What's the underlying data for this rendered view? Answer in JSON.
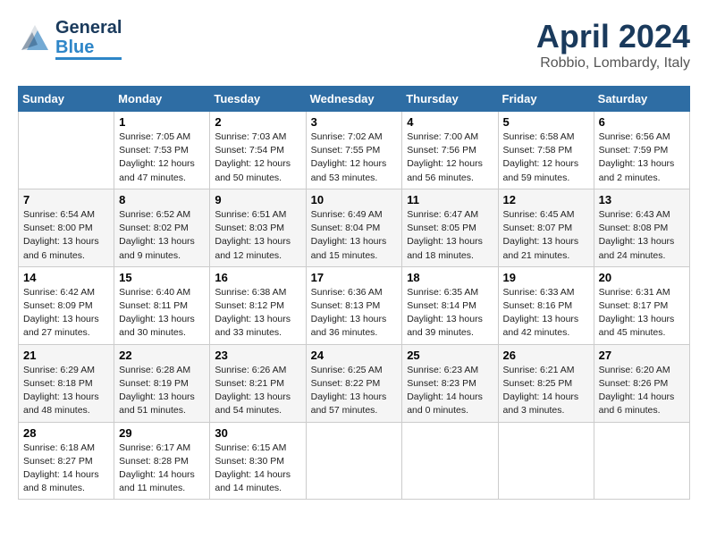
{
  "header": {
    "logo_line1": "General",
    "logo_line2": "Blue",
    "title": "April 2024",
    "subtitle": "Robbio, Lombardy, Italy"
  },
  "columns": [
    "Sunday",
    "Monday",
    "Tuesday",
    "Wednesday",
    "Thursday",
    "Friday",
    "Saturday"
  ],
  "weeks": [
    [
      {
        "num": "",
        "info": ""
      },
      {
        "num": "1",
        "info": "Sunrise: 7:05 AM\nSunset: 7:53 PM\nDaylight: 12 hours\nand 47 minutes."
      },
      {
        "num": "2",
        "info": "Sunrise: 7:03 AM\nSunset: 7:54 PM\nDaylight: 12 hours\nand 50 minutes."
      },
      {
        "num": "3",
        "info": "Sunrise: 7:02 AM\nSunset: 7:55 PM\nDaylight: 12 hours\nand 53 minutes."
      },
      {
        "num": "4",
        "info": "Sunrise: 7:00 AM\nSunset: 7:56 PM\nDaylight: 12 hours\nand 56 minutes."
      },
      {
        "num": "5",
        "info": "Sunrise: 6:58 AM\nSunset: 7:58 PM\nDaylight: 12 hours\nand 59 minutes."
      },
      {
        "num": "6",
        "info": "Sunrise: 6:56 AM\nSunset: 7:59 PM\nDaylight: 13 hours\nand 2 minutes."
      }
    ],
    [
      {
        "num": "7",
        "info": "Sunrise: 6:54 AM\nSunset: 8:00 PM\nDaylight: 13 hours\nand 6 minutes."
      },
      {
        "num": "8",
        "info": "Sunrise: 6:52 AM\nSunset: 8:02 PM\nDaylight: 13 hours\nand 9 minutes."
      },
      {
        "num": "9",
        "info": "Sunrise: 6:51 AM\nSunset: 8:03 PM\nDaylight: 13 hours\nand 12 minutes."
      },
      {
        "num": "10",
        "info": "Sunrise: 6:49 AM\nSunset: 8:04 PM\nDaylight: 13 hours\nand 15 minutes."
      },
      {
        "num": "11",
        "info": "Sunrise: 6:47 AM\nSunset: 8:05 PM\nDaylight: 13 hours\nand 18 minutes."
      },
      {
        "num": "12",
        "info": "Sunrise: 6:45 AM\nSunset: 8:07 PM\nDaylight: 13 hours\nand 21 minutes."
      },
      {
        "num": "13",
        "info": "Sunrise: 6:43 AM\nSunset: 8:08 PM\nDaylight: 13 hours\nand 24 minutes."
      }
    ],
    [
      {
        "num": "14",
        "info": "Sunrise: 6:42 AM\nSunset: 8:09 PM\nDaylight: 13 hours\nand 27 minutes."
      },
      {
        "num": "15",
        "info": "Sunrise: 6:40 AM\nSunset: 8:11 PM\nDaylight: 13 hours\nand 30 minutes."
      },
      {
        "num": "16",
        "info": "Sunrise: 6:38 AM\nSunset: 8:12 PM\nDaylight: 13 hours\nand 33 minutes."
      },
      {
        "num": "17",
        "info": "Sunrise: 6:36 AM\nSunset: 8:13 PM\nDaylight: 13 hours\nand 36 minutes."
      },
      {
        "num": "18",
        "info": "Sunrise: 6:35 AM\nSunset: 8:14 PM\nDaylight: 13 hours\nand 39 minutes."
      },
      {
        "num": "19",
        "info": "Sunrise: 6:33 AM\nSunset: 8:16 PM\nDaylight: 13 hours\nand 42 minutes."
      },
      {
        "num": "20",
        "info": "Sunrise: 6:31 AM\nSunset: 8:17 PM\nDaylight: 13 hours\nand 45 minutes."
      }
    ],
    [
      {
        "num": "21",
        "info": "Sunrise: 6:29 AM\nSunset: 8:18 PM\nDaylight: 13 hours\nand 48 minutes."
      },
      {
        "num": "22",
        "info": "Sunrise: 6:28 AM\nSunset: 8:19 PM\nDaylight: 13 hours\nand 51 minutes."
      },
      {
        "num": "23",
        "info": "Sunrise: 6:26 AM\nSunset: 8:21 PM\nDaylight: 13 hours\nand 54 minutes."
      },
      {
        "num": "24",
        "info": "Sunrise: 6:25 AM\nSunset: 8:22 PM\nDaylight: 13 hours\nand 57 minutes."
      },
      {
        "num": "25",
        "info": "Sunrise: 6:23 AM\nSunset: 8:23 PM\nDaylight: 14 hours\nand 0 minutes."
      },
      {
        "num": "26",
        "info": "Sunrise: 6:21 AM\nSunset: 8:25 PM\nDaylight: 14 hours\nand 3 minutes."
      },
      {
        "num": "27",
        "info": "Sunrise: 6:20 AM\nSunset: 8:26 PM\nDaylight: 14 hours\nand 6 minutes."
      }
    ],
    [
      {
        "num": "28",
        "info": "Sunrise: 6:18 AM\nSunset: 8:27 PM\nDaylight: 14 hours\nand 8 minutes."
      },
      {
        "num": "29",
        "info": "Sunrise: 6:17 AM\nSunset: 8:28 PM\nDaylight: 14 hours\nand 11 minutes."
      },
      {
        "num": "30",
        "info": "Sunrise: 6:15 AM\nSunset: 8:30 PM\nDaylight: 14 hours\nand 14 minutes."
      },
      {
        "num": "",
        "info": ""
      },
      {
        "num": "",
        "info": ""
      },
      {
        "num": "",
        "info": ""
      },
      {
        "num": "",
        "info": ""
      }
    ]
  ]
}
